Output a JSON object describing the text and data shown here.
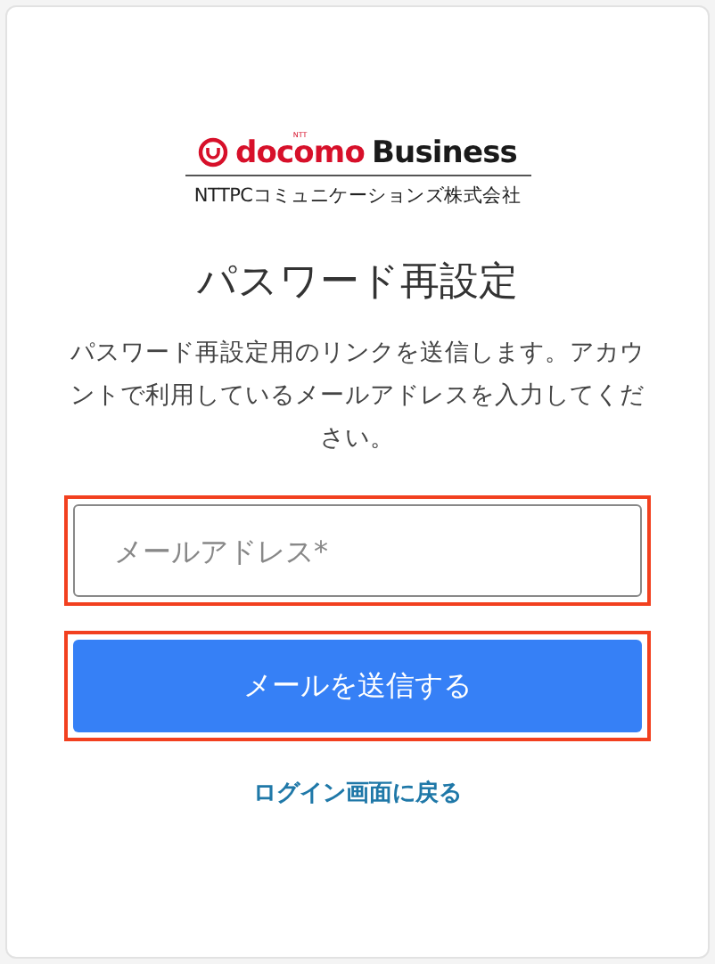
{
  "logo": {
    "mark": "NTT",
    "brand": "docomo",
    "suffix": "Business",
    "company": "NTTPCコミュニケーションズ株式会社"
  },
  "title": "パスワード再設定",
  "description": "パスワード再設定用のリンクを送信します。アカウントで利用しているメールアドレスを入力してください。",
  "email_field": {
    "placeholder": "メールアドレス*",
    "highlighted": true
  },
  "submit_button": {
    "label": "メールを送信する",
    "highlighted": true
  },
  "back_link": "ログイン画面に戻る"
}
